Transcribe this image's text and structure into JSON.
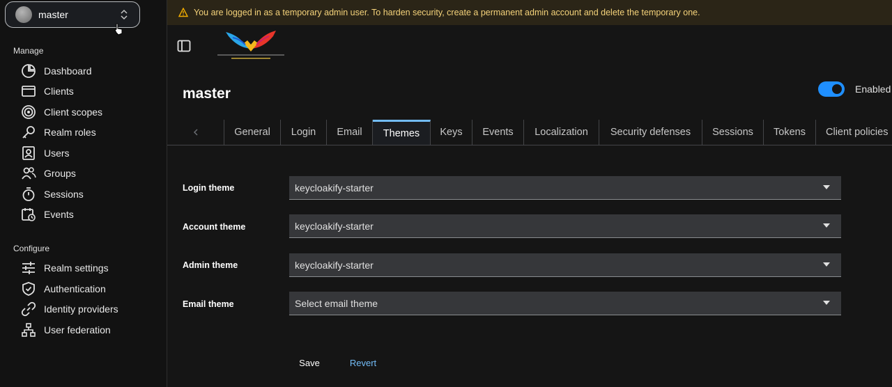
{
  "realm_selector": {
    "name": "master"
  },
  "sidebar": {
    "manage_title": "Manage",
    "manage_items": [
      {
        "label": "Dashboard",
        "icon": "dashboard-icon"
      },
      {
        "label": "Clients",
        "icon": "clients-icon"
      },
      {
        "label": "Client scopes",
        "icon": "client-scopes-icon"
      },
      {
        "label": "Realm roles",
        "icon": "key-icon"
      },
      {
        "label": "Users",
        "icon": "user-icon"
      },
      {
        "label": "Groups",
        "icon": "users-icon"
      },
      {
        "label": "Sessions",
        "icon": "stopwatch-icon"
      },
      {
        "label": "Events",
        "icon": "calendar-icon"
      }
    ],
    "configure_title": "Configure",
    "configure_items": [
      {
        "label": "Realm settings",
        "icon": "sliders-icon"
      },
      {
        "label": "Authentication",
        "icon": "shield-icon"
      },
      {
        "label": "Identity providers",
        "icon": "link-icon"
      },
      {
        "label": "User federation",
        "icon": "sitemap-icon"
      }
    ]
  },
  "banner": {
    "text": "You are logged in as a temporary admin user. To harden security, create a permanent admin account and delete the temporary one."
  },
  "header": {
    "title": "master",
    "toggle_label": "Enabled",
    "enabled": true
  },
  "tabs": [
    {
      "label": "General"
    },
    {
      "label": "Login"
    },
    {
      "label": "Email"
    },
    {
      "label": "Themes",
      "active": true
    },
    {
      "label": "Keys"
    },
    {
      "label": "Events"
    },
    {
      "label": "Localization"
    },
    {
      "label": "Security defenses"
    },
    {
      "label": "Sessions"
    },
    {
      "label": "Tokens"
    },
    {
      "label": "Client policies"
    }
  ],
  "form": {
    "fields": [
      {
        "label": "Login theme",
        "value": "keycloakify-starter"
      },
      {
        "label": "Account theme",
        "value": "keycloakify-starter"
      },
      {
        "label": "Admin theme",
        "value": "keycloakify-starter"
      },
      {
        "label": "Email theme",
        "value": "Select email theme"
      }
    ],
    "save_label": "Save",
    "revert_label": "Revert"
  },
  "colors": {
    "accent": "#73bcf7",
    "toggle": "#1f8fff",
    "warning": "#f0ab00"
  }
}
